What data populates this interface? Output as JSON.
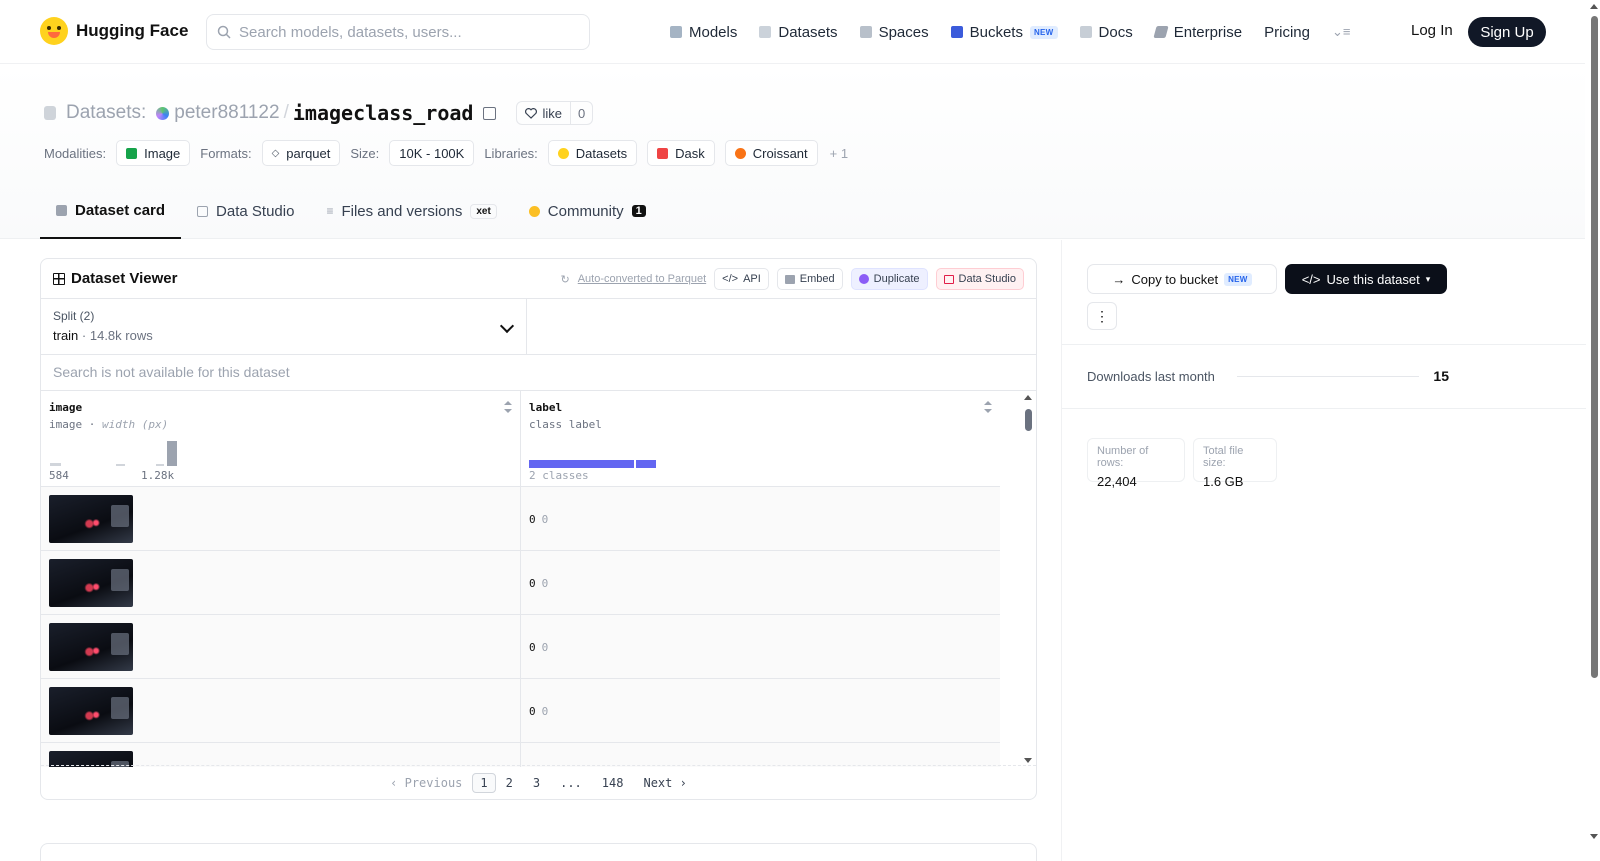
{
  "nav": {
    "brand": "Hugging Face",
    "search_placeholder": "Search models, datasets, users...",
    "links": [
      {
        "label": "Models"
      },
      {
        "label": "Datasets"
      },
      {
        "label": "Spaces"
      },
      {
        "label": "Buckets",
        "badge": "NEW"
      },
      {
        "label": "Docs"
      },
      {
        "label": "Enterprise"
      },
      {
        "label": "Pricing"
      }
    ],
    "login": "Log In",
    "signup": "Sign Up"
  },
  "header": {
    "section": "Datasets:",
    "owner": "peter881122",
    "repo": "imageclass_road",
    "like_label": "like",
    "like_count": "0",
    "tags": {
      "modalities_label": "Modalities:",
      "modality": "Image",
      "formats_label": "Formats:",
      "format": "parquet",
      "size_label": "Size:",
      "size": "10K - 100K",
      "libraries_label": "Libraries:",
      "libraries": [
        "Datasets",
        "Dask",
        "Croissant"
      ],
      "more": "+ 1"
    },
    "tabs": [
      {
        "label": "Dataset card"
      },
      {
        "label": "Data Studio"
      },
      {
        "label": "Files and versions",
        "badge": "xet"
      },
      {
        "label": "Community",
        "badge": "1"
      }
    ]
  },
  "viewer": {
    "title": "Dataset Viewer",
    "auto_converted": "Auto-converted",
    "auto_suffix": " to Parquet",
    "actions": [
      "API",
      "Embed",
      "Duplicate",
      "Data Studio"
    ],
    "split_label": "Split (2)",
    "split_value": "train",
    "split_rows": "14.8k rows",
    "search_note": "Search is not available for this dataset",
    "columns": [
      {
        "name": "image",
        "type": "image",
        "subtype": "width (px)",
        "min": "584",
        "max": "1.28k"
      },
      {
        "name": "label",
        "type": "class label",
        "classes": "2 classes",
        "class_shares": [
          0.8,
          0.2
        ]
      }
    ],
    "rows": [
      {
        "label": "0",
        "label_name": "0"
      },
      {
        "label": "0",
        "label_name": "0"
      },
      {
        "label": "0",
        "label_name": "0"
      },
      {
        "label": "0",
        "label_name": "0"
      },
      {
        "label": "",
        "label_name": ""
      }
    ],
    "pager": {
      "prev": "Previous",
      "pages": [
        "1",
        "2",
        "3",
        "...",
        "148"
      ],
      "next": "Next"
    }
  },
  "sidebar": {
    "copy_bucket": "Copy to bucket",
    "copy_badge": "NEW",
    "use_dataset": "Use this dataset",
    "downloads_label": "Downloads last month",
    "downloads_value": "15",
    "rows_label": "Number of rows:",
    "rows_value": "22,404",
    "size_label": "Total file size:",
    "size_value": "1.6 GB"
  }
}
